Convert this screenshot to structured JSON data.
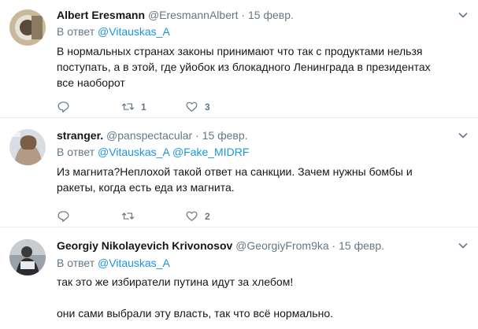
{
  "tweets": [
    {
      "name": "Albert Eresmann",
      "handle": "@EresmannAlbert",
      "dot": "·",
      "time": "15 февр.",
      "reply_prefix": "В ответ",
      "reply_to": [
        "@Vitauskas_A"
      ],
      "text": [
        "В нормальных странах законы принимают что так с продуктами нельзя поступать, а в этой, где уйобок из блокадного Ленинграда в президентах все наоборот"
      ],
      "retweets": "1",
      "likes": "3"
    },
    {
      "name": "stranger.",
      "handle": "@panspectacular",
      "dot": "·",
      "time": "15 февр.",
      "reply_prefix": "В ответ",
      "reply_to": [
        "@Vitauskas_A",
        "@Fake_MIDRF"
      ],
      "text": [
        "Из магнита?Неплохой такой ответ на санкции. Зачем нужны бомбы и ракеты, когда есть еда из магнита."
      ],
      "retweets": "",
      "likes": "2"
    },
    {
      "name": "Georgiy Nikolayevich Krivonosov",
      "handle": "@GeorgiyFrom9ka",
      "dot": "·",
      "time": "15 февр.",
      "reply_prefix": "В ответ",
      "reply_to": [
        "@Vitauskas_A"
      ],
      "text": [
        "так это же избиратели путина идут за хлебом!",
        "они сами выбрали эту власть, так что всё нормально."
      ],
      "retweets": "",
      "likes": ""
    }
  ],
  "icons": {
    "reply": "reply-icon",
    "retweet": "retweet-icon",
    "like": "heart-icon",
    "menu": "chevron-down-icon"
  },
  "colors": {
    "link": "#1b95e0",
    "muted": "#657786",
    "text": "#14171a",
    "divider": "#e6ecf0"
  }
}
